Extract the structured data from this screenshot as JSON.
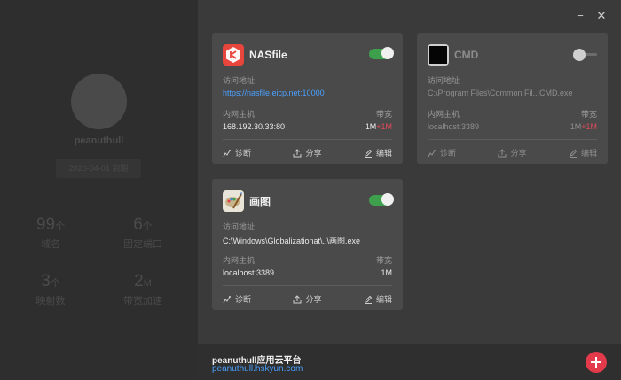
{
  "profile": {
    "username": "peanuthull",
    "expiry": "2020-04-01 到期",
    "stats": [
      {
        "value": "99",
        "unit": "个",
        "label": "域名"
      },
      {
        "value": "6",
        "unit": "个",
        "label": "固定端口"
      },
      {
        "value": "3",
        "unit": "个",
        "label": "映射数"
      },
      {
        "value": "2",
        "unit": "M",
        "label": "带宽加速"
      }
    ]
  },
  "window": {
    "minimize": "−",
    "close": "✕"
  },
  "labels": {
    "address": "访问地址",
    "host": "内网主机",
    "bandwidth": "带宽",
    "diagnose": "诊断",
    "share": "分享",
    "edit": "编辑"
  },
  "cards": [
    {
      "name": "NASfile",
      "address": "https://nasfile.eicp.net:10000",
      "host": "168.192.30.33:80",
      "bw": "1M",
      "bw_plus": "+1M",
      "enabled": true,
      "icon": "nasfile-icon"
    },
    {
      "name": "CMD",
      "address": "C:\\Program Files\\Common Fil...CMD.exe",
      "host": "localhost:3389",
      "bw": "1M",
      "bw_plus": "+1M",
      "enabled": false,
      "icon": "cmd-icon"
    },
    {
      "name": "画图",
      "address": "C:\\Windows\\Globalizationat\\..\\画图.exe",
      "host": "localhost:3389",
      "bw": "1M",
      "bw_plus": "",
      "enabled": true,
      "icon": "paint-icon"
    }
  ],
  "footer": {
    "title": "peanuthull应用云平台",
    "link": "peanuthull.hskyun.com"
  },
  "colors": {
    "accent": "#4aa0ff",
    "toggle_on": "#3ea04d",
    "add": "#e23a4a",
    "plus": "#e04a5a"
  }
}
